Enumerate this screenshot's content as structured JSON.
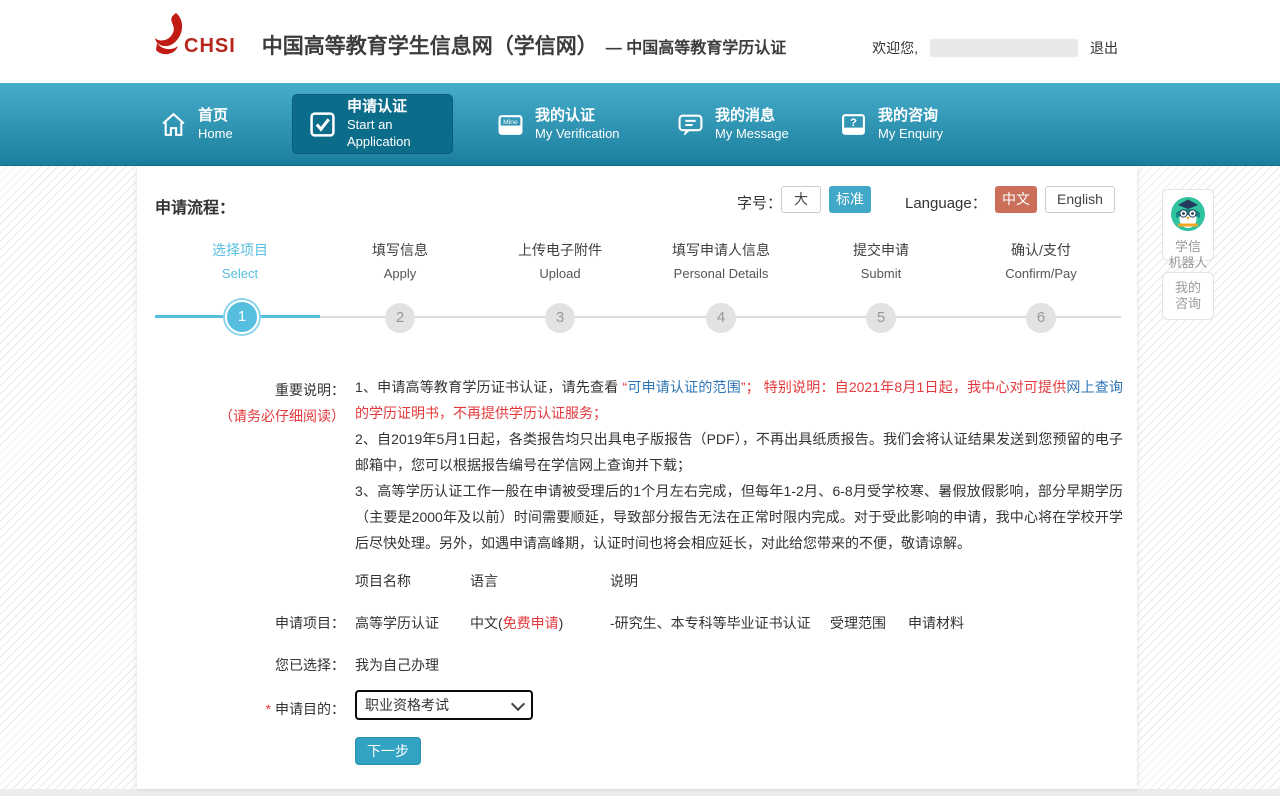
{
  "header": {
    "logo": "CHSI",
    "title": "中国高等教育学生信息网（学信网）",
    "subtitle": "— 中国高等教育学历认证",
    "welcome": "欢迎您,",
    "logout": "退出"
  },
  "nav": {
    "items": [
      {
        "zh": "首页",
        "en": "Home"
      },
      {
        "zh": "申请认证",
        "en": "Start an Application"
      },
      {
        "zh": "我的认证",
        "en": "My Verification"
      },
      {
        "zh": "我的消息",
        "en": "My Message"
      },
      {
        "zh": "我的咨询",
        "en": "My Enquiry"
      }
    ]
  },
  "controls": {
    "page_title": "申请流程：",
    "font_label": "字号：",
    "font_large": "大",
    "font_standard": "标准",
    "language_label": "Language：",
    "lang_zh": "中文",
    "lang_english": "English"
  },
  "steps": [
    {
      "zh": "选择项目",
      "en": "Select",
      "num": "1"
    },
    {
      "zh": "填写信息",
      "en": "Apply",
      "num": "2"
    },
    {
      "zh": "上传电子附件",
      "en": "Upload",
      "num": "3"
    },
    {
      "zh": "填写申请人信息",
      "en": "Personal Details",
      "num": "4"
    },
    {
      "zh": "提交申请",
      "en": "Submit",
      "num": "5"
    },
    {
      "zh": "确认/支付",
      "en": "Confirm/Pay",
      "num": "6"
    }
  ],
  "notes": {
    "label": "重要说明：",
    "label_warning": "（请务必仔细阅读）",
    "n1_text": "1、申请高等教育学历证书认证，请先查看 ",
    "n1_quote_open": "“",
    "n1_link_scope": "可申请认证的范围",
    "n1_quote_close": "”；  ",
    "n1_special": "特别说明：自2021年8月1日起，我中心对可提供",
    "n1_link_online": "网上查询",
    "n1_special_end": "的学历证明书，不再提供学历认证服务；",
    "n2": "2、自2019年5月1日起，各类报告均只出具电子版报告（PDF），不再出具纸质报告。我们会将认证结果发送到您预留的电子邮箱中，您可以根据报告编号在学信网上查询并下载；",
    "n3": "3、高等学历认证工作一般在申请被受理后的1个月左右完成，但每年1-2月、6-8月受学校寒、暑假放假影响，部分早期学历（主要是2000年及以前）时间需要顺延，导致部分报告无法在正常时限内完成。对于受此影响的申请，我中心将在学校开学后尽快处理。另外，如遇申请高峰期，认证时间也将会相应延长，对此给您带来的不便，敬请谅解。"
  },
  "project": {
    "col_name": "项目名称",
    "col_lang": "语言",
    "col_desc": "说明",
    "row_label": "申请项目：",
    "name": "高等学历认证",
    "lang_pre": "中文(",
    "lang_free": "免费申请",
    "lang_post": ")",
    "desc": "-研究生、本专科等毕业证书认证",
    "link_scope": "受理范围",
    "link_materials": "申请材料"
  },
  "form": {
    "selected_label": "您已选择：",
    "selected_value": "我为自己办理",
    "required_mark": "*",
    "purpose_label": " 申请目的：",
    "purpose_value": "职业资格考试",
    "next_button": "下一步"
  },
  "sidebar": {
    "robot_line1": "学信",
    "robot_line2": "机器人",
    "enquiry_line1": "我的",
    "enquiry_line2": "咨询"
  },
  "colors": {
    "navbar_top": "#47adcb",
    "navbar_bottom": "#1b7e9d",
    "nav_active": "#0c6d8b",
    "step_blue": "#56bfe0",
    "link_blue": "#2e74b5",
    "warn_red": "#e4393c",
    "btn_teal": "#33a3c4",
    "btn_lang_red": "#c96f5a",
    "logo_red": "#b5271d"
  }
}
